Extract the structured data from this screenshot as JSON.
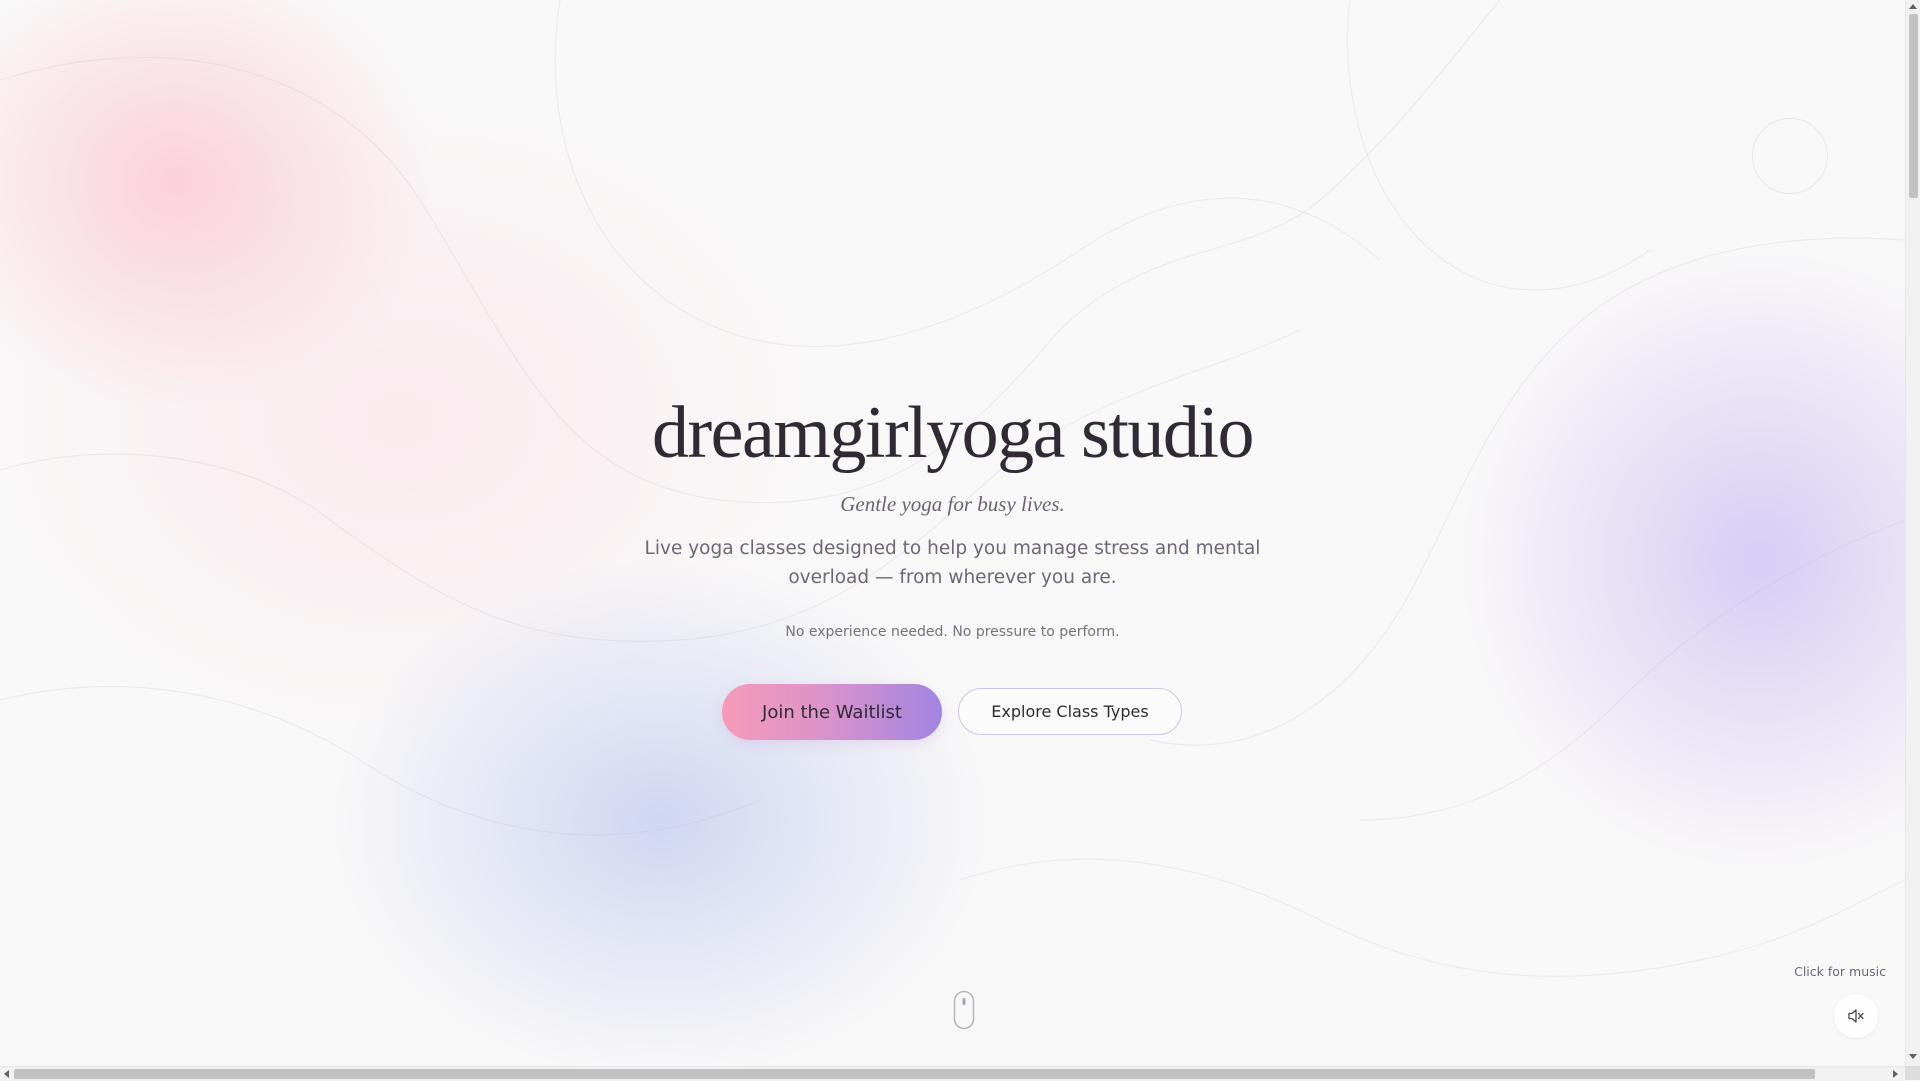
{
  "hero": {
    "title": "dreamgirlyoga studio",
    "tagline": "Gentle yoga for busy lives.",
    "description": "Live yoga classes designed to help you manage stress and mental overload — from wherever you are.",
    "note": "No experience needed. No pressure to perform.",
    "primary_button": "Join the Waitlist",
    "secondary_button": "Explore Class Types"
  },
  "icons": {
    "sound_wave": "sound-wave-icon",
    "scroll_hint": "mouse-scroll-icon",
    "mute": "speaker-muted-icon"
  },
  "music": {
    "label": "Click for music"
  },
  "colors": {
    "title": "#2f2a34",
    "accent_pink": "#f59bb7",
    "accent_purple": "#a184e3",
    "outline": "#cfc6ea",
    "background": "#f9f8f8"
  }
}
